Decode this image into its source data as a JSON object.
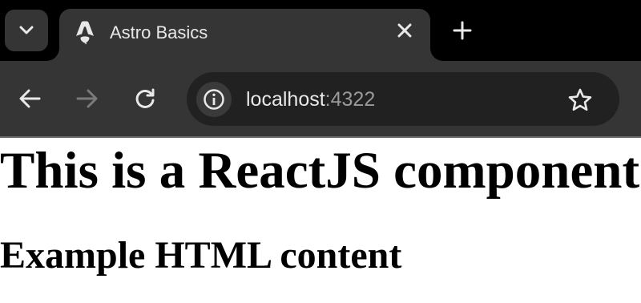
{
  "browser": {
    "tab": {
      "title": "Astro Basics"
    },
    "address_bar": {
      "host": "localhost",
      "port": ":4322"
    }
  },
  "page": {
    "heading": "This is a ReactJS component!",
    "subheading": "Example HTML content"
  },
  "icons": {
    "tab_search": "chevron-down-icon",
    "favicon": "astro-logo-icon",
    "close": "close-icon",
    "new_tab": "plus-icon",
    "back": "arrow-left-icon",
    "forward": "arrow-right-icon",
    "reload": "reload-icon",
    "site_info": "info-icon",
    "bookmark": "star-icon"
  },
  "colors": {
    "tabstrip": "#000000",
    "toolbar": "#353535",
    "omnibox": "#212121",
    "page_background": "#ffffff"
  }
}
